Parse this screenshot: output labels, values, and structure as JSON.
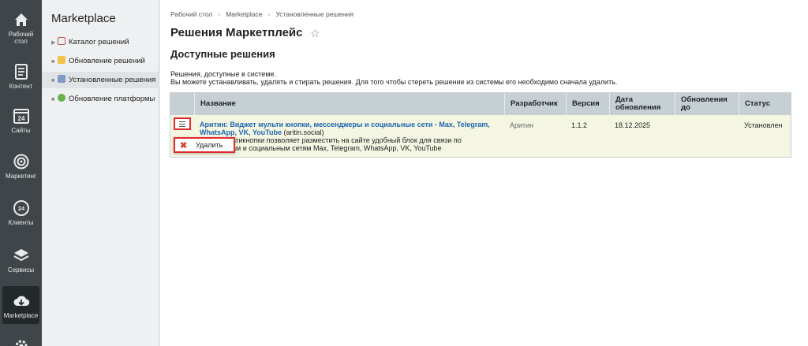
{
  "leftnav": {
    "items": [
      {
        "label": "Рабочий\nстол",
        "icon": "home-icon"
      },
      {
        "label": "Контент",
        "icon": "document-icon"
      },
      {
        "label": "Сайты",
        "icon": "calendar-24-icon"
      },
      {
        "label": "Маркетинг",
        "icon": "target-icon"
      },
      {
        "label": "Клиенты",
        "icon": "clients-24-icon"
      },
      {
        "label": "Сервисы",
        "icon": "layers-icon"
      },
      {
        "label": "Marketplace",
        "icon": "cloud-download-icon"
      }
    ]
  },
  "subnav": {
    "title": "Marketplace",
    "items": [
      {
        "label": "Каталог решений"
      },
      {
        "label": "Обновление решений"
      },
      {
        "label": "Установленные решения"
      },
      {
        "label": "Обновление платформы"
      }
    ]
  },
  "breadcrumb": [
    "Рабочий стол",
    "Marketplace",
    "Установленные решения"
  ],
  "page": {
    "title": "Решения Маркетплейс",
    "section": "Доступные решения",
    "desc1": "Решения, доступные в системе.",
    "desc2": "Вы можете устанавливать, удалять и стирать решения. Для того чтобы стереть решение из системы его необходимо сначала удалить."
  },
  "table": {
    "headers": {
      "name": "Название",
      "developer": "Разработчик",
      "version": "Версия",
      "date1": "Дата",
      "date2": "обновления",
      "upd1": "Обновления",
      "upd2": "до",
      "status": "Статус"
    },
    "row": {
      "name": "Аритин: Виджет мульти кнопки, мессенджеры и социальные сети - Max, Telegram,",
      "name2": "WhatsApp, VK, YouTube",
      "code": "(aritin.social)",
      "desc1": "льтикнопки позволяет разместить на сайте удобный блок для связи по",
      "desc2": "рам и социальным сетям Max, Telegram, WhatsApp, VK, YouTube",
      "developer": "Аритин",
      "version": "1.1.2",
      "date": "18.12.2025",
      "updates_until": "",
      "status": "Установлен"
    }
  },
  "popup": {
    "delete_label": "Удалить"
  },
  "colors": {
    "accent": "#2067b0",
    "highlight": "#e02b2b",
    "row_bg": "#f4f6e2"
  }
}
